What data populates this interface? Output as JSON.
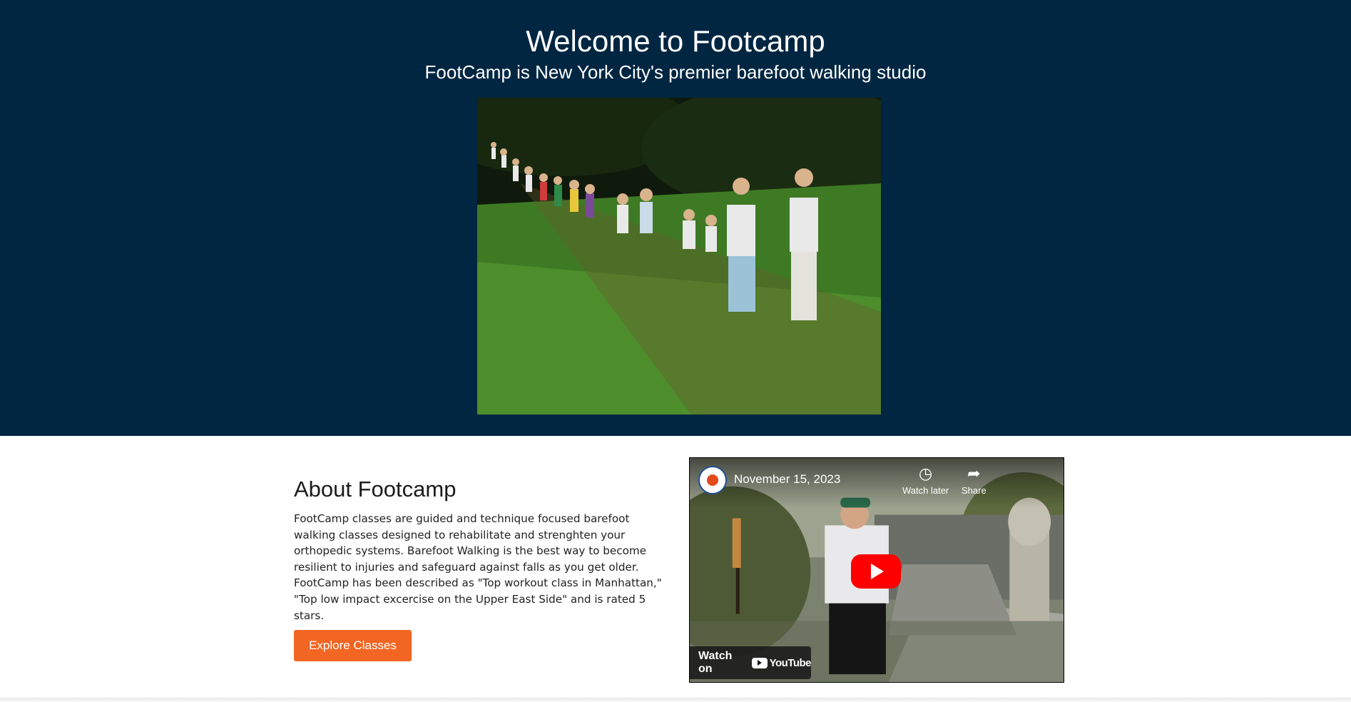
{
  "hero": {
    "title": "Welcome to Footcamp",
    "subtitle": "FootCamp is New York City's premier barefoot walking studio",
    "photo_description": "group-walk-photo",
    "bg_color": "#002642"
  },
  "about": {
    "heading": "About Footcamp",
    "body": "FootCamp classes are guided and technique focused barefoot walking classes designed to rehabilitate and strenghten your orthopedic systems. Barefoot Walking is the best way to become resilient to injuries and safeguard against falls as you get older. FootCamp has been described as \"Top workout class in Manhattan,\" \"Top low impact excercise on the Upper East Side\" and is rated 5 stars.",
    "button_label": "Explore Classes",
    "button_color": "#f26522"
  },
  "video": {
    "title": "November 15, 2023",
    "watch_later_label": "Watch later",
    "share_label": "Share",
    "watch_on_label": "Watch on",
    "platform_label": "YouTube",
    "play_color": "#ff0000",
    "icons": [
      "channel-logo-icon",
      "clock-icon",
      "share-icon",
      "play-icon",
      "youtube-logo-icon"
    ]
  }
}
